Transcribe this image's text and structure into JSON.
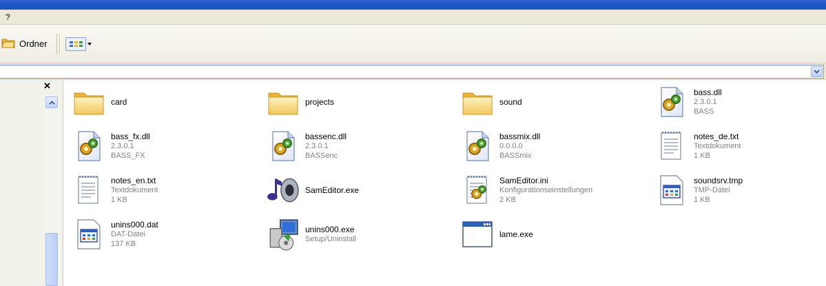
{
  "menu": {
    "help_label": "?"
  },
  "toolbar": {
    "folders_label": "Ordner"
  },
  "files": [
    {
      "name": "card",
      "icon": "folder-icon"
    },
    {
      "name": "projects",
      "icon": "folder-icon"
    },
    {
      "name": "sound",
      "icon": "folder-icon"
    },
    {
      "name": "bass.dll",
      "line2": "2.3.0.1",
      "line3": "BASS",
      "icon": "dll-icon"
    },
    {
      "name": "bass_fx.dll",
      "line2": "2.3.0.1",
      "line3": "BASS_FX",
      "icon": "dll-icon"
    },
    {
      "name": "bassenc.dll",
      "line2": "2.3.0.1",
      "line3": "BASSenc",
      "icon": "dll-icon"
    },
    {
      "name": "bassmix.dll",
      "line2": "0.0.0.0",
      "line3": "BASSmix",
      "icon": "dll-icon"
    },
    {
      "name": "notes_de.txt",
      "line2": "Textdokument",
      "line3": "1 KB",
      "icon": "text-file-icon"
    },
    {
      "name": "notes_en.txt",
      "line2": "Textdokument",
      "line3": "1 KB",
      "icon": "text-file-icon"
    },
    {
      "name": "SamEditor.exe",
      "icon": "music-app-icon"
    },
    {
      "name": "SamEditor.ini",
      "line2": "Konfigurationseinstellungen",
      "line3": "2 KB",
      "icon": "config-file-icon"
    },
    {
      "name": "soundsrv.tmp",
      "line2": "TMP-Datei",
      "line3": "1 KB",
      "icon": "generic-file-icon"
    },
    {
      "name": "unins000.dat",
      "line2": "DAT-Datei",
      "line3": "137 KB",
      "icon": "generic-file-icon"
    },
    {
      "name": "unins000.exe",
      "line2": "Setup/Uninstall",
      "icon": "setup-icon"
    },
    {
      "name": "lame.exe",
      "icon": "app-window-icon"
    }
  ],
  "colors": {
    "titlebar": "#2357c7",
    "chrome": "#ece9d8",
    "meta_text": "#808080"
  }
}
